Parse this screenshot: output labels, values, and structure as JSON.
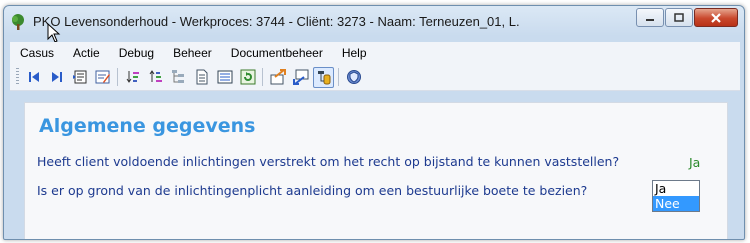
{
  "window": {
    "title": "PKO Levensonderhoud - Werkproces: 3744 - Cliënt: 3273 - Naam: Terneuzen_01, L.",
    "app_icon": "tree-icon",
    "controls": [
      "minimize-icon",
      "maximize-icon",
      "close-icon"
    ]
  },
  "menu": {
    "items": [
      {
        "label": "Casus"
      },
      {
        "label": "Actie"
      },
      {
        "label": "Debug"
      },
      {
        "label": "Beheer"
      },
      {
        "label": "Documentbeheer"
      },
      {
        "label": "Help"
      }
    ]
  },
  "toolbar": {
    "icons": [
      "first-record-icon",
      "last-record-icon",
      "comment-icon",
      "edit-form-icon",
      "sort-ascending-icon",
      "sort-descending-icon",
      "tree-view-icon",
      "document-icon",
      "list-icon",
      "refresh-icon",
      "send-icon",
      "receive-icon",
      "database-icon",
      "shield-icon"
    ]
  },
  "content": {
    "heading": "Algemene gegevens",
    "questions": [
      {
        "text": "Heeft client voldoende inlichtingen verstrekt om het recht op bijstand te kunnen vaststellen?",
        "answer": "Ja"
      },
      {
        "text": "Is er op grond van de inlichtingenplicht aanleiding om een bestuurlijke boete te bezien?",
        "options": [
          "Ja",
          "Nee"
        ],
        "selected": "Nee"
      }
    ]
  },
  "colors": {
    "heading": "#3a96e0",
    "question_text": "#1d3a8f",
    "answer": "#2b8a2b",
    "selection": "#3399ff"
  }
}
